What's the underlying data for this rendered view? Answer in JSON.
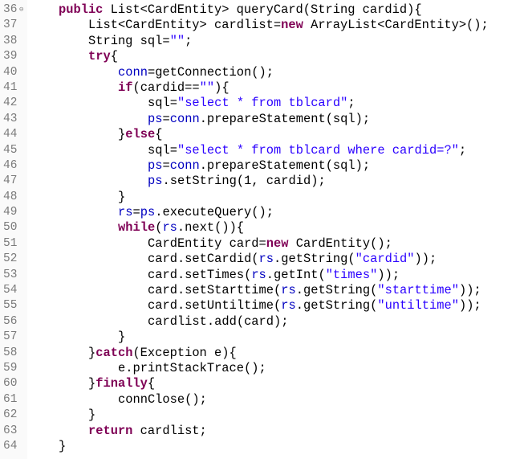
{
  "editor": {
    "colors": {
      "keyword": "#7f0055",
      "string": "#2a00ff",
      "field": "#0000c0",
      "line_number": "#7a7a7a"
    },
    "fold_icon_line": 36,
    "lines": [
      {
        "n": "36",
        "indent": 1,
        "tokens": [
          [
            "k",
            "public"
          ],
          [
            "p",
            " List<CardEntity> queryCard(String cardid){"
          ]
        ]
      },
      {
        "n": "37",
        "indent": 2,
        "tokens": [
          [
            "p",
            "List<CardEntity> cardlist="
          ],
          [
            "k",
            "new"
          ],
          [
            "p",
            " ArrayList<CardEntity>();"
          ]
        ]
      },
      {
        "n": "38",
        "indent": 2,
        "tokens": [
          [
            "p",
            "String sql="
          ],
          [
            "s",
            "\"\""
          ],
          [
            "p",
            ";"
          ]
        ]
      },
      {
        "n": "39",
        "indent": 2,
        "tokens": [
          [
            "k",
            "try"
          ],
          [
            "p",
            "{"
          ]
        ]
      },
      {
        "n": "40",
        "indent": 3,
        "tokens": [
          [
            "f",
            "conn"
          ],
          [
            "p",
            "=getConnection();"
          ]
        ]
      },
      {
        "n": "41",
        "indent": 3,
        "tokens": [
          [
            "k",
            "if"
          ],
          [
            "p",
            "(cardid=="
          ],
          [
            "s",
            "\"\""
          ],
          [
            "p",
            "){"
          ]
        ]
      },
      {
        "n": "42",
        "indent": 4,
        "tokens": [
          [
            "p",
            "sql="
          ],
          [
            "s",
            "\"select * from tblcard\""
          ],
          [
            "p",
            ";"
          ]
        ]
      },
      {
        "n": "43",
        "indent": 4,
        "tokens": [
          [
            "f",
            "ps"
          ],
          [
            "p",
            "="
          ],
          [
            "f",
            "conn"
          ],
          [
            "p",
            ".prepareStatement(sql);"
          ]
        ]
      },
      {
        "n": "44",
        "indent": 3,
        "tokens": [
          [
            "p",
            "}"
          ],
          [
            "k",
            "else"
          ],
          [
            "p",
            "{"
          ]
        ]
      },
      {
        "n": "45",
        "indent": 4,
        "tokens": [
          [
            "p",
            "sql="
          ],
          [
            "s",
            "\"select * from tblcard where cardid=?\""
          ],
          [
            "p",
            ";"
          ]
        ]
      },
      {
        "n": "46",
        "indent": 4,
        "tokens": [
          [
            "f",
            "ps"
          ],
          [
            "p",
            "="
          ],
          [
            "f",
            "conn"
          ],
          [
            "p",
            ".prepareStatement(sql);"
          ]
        ]
      },
      {
        "n": "47",
        "indent": 4,
        "tokens": [
          [
            "f",
            "ps"
          ],
          [
            "p",
            ".setString(1, cardid);"
          ]
        ]
      },
      {
        "n": "48",
        "indent": 3,
        "tokens": [
          [
            "p",
            "}"
          ]
        ]
      },
      {
        "n": "49",
        "indent": 3,
        "tokens": [
          [
            "f",
            "rs"
          ],
          [
            "p",
            "="
          ],
          [
            "f",
            "ps"
          ],
          [
            "p",
            ".executeQuery();"
          ]
        ]
      },
      {
        "n": "50",
        "indent": 3,
        "tokens": [
          [
            "k",
            "while"
          ],
          [
            "p",
            "("
          ],
          [
            "f",
            "rs"
          ],
          [
            "p",
            ".next()){"
          ]
        ]
      },
      {
        "n": "51",
        "indent": 4,
        "tokens": [
          [
            "p",
            "CardEntity card="
          ],
          [
            "k",
            "new"
          ],
          [
            "p",
            " CardEntity();"
          ]
        ]
      },
      {
        "n": "52",
        "indent": 4,
        "tokens": [
          [
            "p",
            "card.setCardid("
          ],
          [
            "f",
            "rs"
          ],
          [
            "p",
            ".getString("
          ],
          [
            "s",
            "\"cardid\""
          ],
          [
            "p",
            "));"
          ]
        ]
      },
      {
        "n": "53",
        "indent": 4,
        "tokens": [
          [
            "p",
            "card.setTimes("
          ],
          [
            "f",
            "rs"
          ],
          [
            "p",
            ".getInt("
          ],
          [
            "s",
            "\"times\""
          ],
          [
            "p",
            "));"
          ]
        ]
      },
      {
        "n": "54",
        "indent": 4,
        "tokens": [
          [
            "p",
            "card.setStarttime("
          ],
          [
            "f",
            "rs"
          ],
          [
            "p",
            ".getString("
          ],
          [
            "s",
            "\"starttime\""
          ],
          [
            "p",
            "));"
          ]
        ]
      },
      {
        "n": "55",
        "indent": 4,
        "tokens": [
          [
            "p",
            "card.setUntiltime("
          ],
          [
            "f",
            "rs"
          ],
          [
            "p",
            ".getString("
          ],
          [
            "s",
            "\"untiltime\""
          ],
          [
            "p",
            "));"
          ]
        ]
      },
      {
        "n": "56",
        "indent": 4,
        "tokens": [
          [
            "p",
            "cardlist.add(card);"
          ]
        ]
      },
      {
        "n": "57",
        "indent": 3,
        "tokens": [
          [
            "p",
            "}"
          ]
        ]
      },
      {
        "n": "58",
        "indent": 2,
        "tokens": [
          [
            "p",
            "}"
          ],
          [
            "k",
            "catch"
          ],
          [
            "p",
            "(Exception e){"
          ]
        ]
      },
      {
        "n": "59",
        "indent": 3,
        "tokens": [
          [
            "p",
            "e.printStackTrace();"
          ]
        ]
      },
      {
        "n": "60",
        "indent": 2,
        "tokens": [
          [
            "p",
            "}"
          ],
          [
            "k",
            "finally"
          ],
          [
            "p",
            "{"
          ]
        ]
      },
      {
        "n": "61",
        "indent": 3,
        "tokens": [
          [
            "p",
            "connClose();"
          ]
        ]
      },
      {
        "n": "62",
        "indent": 2,
        "tokens": [
          [
            "p",
            "}"
          ]
        ]
      },
      {
        "n": "63",
        "indent": 2,
        "tokens": [
          [
            "k",
            "return"
          ],
          [
            "p",
            " cardlist;"
          ]
        ]
      },
      {
        "n": "64",
        "indent": 1,
        "tokens": [
          [
            "p",
            "}"
          ]
        ]
      }
    ]
  }
}
